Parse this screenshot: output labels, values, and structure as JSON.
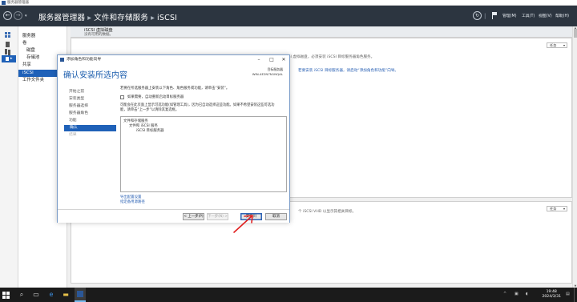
{
  "window": {
    "title": "服务器管理器"
  },
  "nav": {
    "breadcrumb": [
      "服务器管理器",
      "文件和存储服务",
      "iSCSI"
    ],
    "menu": [
      "管理(M)",
      "工具(T)",
      "视图(V)",
      "帮助(H)"
    ]
  },
  "sidebar_tree": {
    "items": [
      {
        "label": "服务器",
        "indent": false,
        "selected": false
      },
      {
        "label": "卷",
        "indent": false,
        "selected": false
      },
      {
        "label": "磁盘",
        "indent": true,
        "selected": false
      },
      {
        "label": "存储池",
        "indent": true,
        "selected": false
      },
      {
        "label": "共享",
        "indent": false,
        "selected": false
      },
      {
        "label": "iSCSI",
        "indent": false,
        "selected": true
      },
      {
        "label": "工作文件夹",
        "indent": false,
        "selected": false
      }
    ]
  },
  "content": {
    "header_title": "iSCSI 虚拟磁盘",
    "header_subtitle": "没有可用的数据。",
    "tasks_label": "任务",
    "hint_main": "要使用 iSCSI 虚拟磁盘，必须安装 iSCSI 目标服务器角色服务。",
    "hint_link": "若要安装 iSCSI 目标服务器，请启动“添加角色和功能”向导。",
    "hint_lower": "个 iSCSI VHD 以显示其相关目标。"
  },
  "dialog": {
    "title": "添加角色和功能向导",
    "heading": "确认安装所选内容",
    "target_server_label": "目标服务器",
    "target_server_name": "WIN-4E2N7N1NQAL",
    "steps": [
      {
        "label": "开始之前",
        "state": "normal"
      },
      {
        "label": "安装类型",
        "state": "normal"
      },
      {
        "label": "服务器选择",
        "state": "normal"
      },
      {
        "label": "服务器角色",
        "state": "normal"
      },
      {
        "label": "功能",
        "state": "normal"
      },
      {
        "label": "确认",
        "state": "active"
      },
      {
        "label": "结果",
        "state": "disabled"
      }
    ],
    "intro": "若要在所选服务器上安装以下角色、角色服务或功能，请单击“安装”。",
    "restart_checkbox": "如果需要，自动重新启动目标服务器",
    "note_line1": "可能会在此页面上显示可选功能(如管理工具)，因为已自动选择这些功能。如果不希望安装这些可选功",
    "note_line2": "能，请单击“上一步”以清除其复选框。",
    "features": [
      {
        "label": "文件和存储服务",
        "level": 0
      },
      {
        "label": "文件和 iSCSI 服务",
        "level": 1
      },
      {
        "label": "iSCSI 目标服务器",
        "level": 2
      }
    ],
    "links": [
      "导出配置设置",
      "指定备用源路径"
    ],
    "buttons": {
      "prev": "< 上一步(P)",
      "next": "下一步(N) >",
      "install": "安装(I)",
      "cancel": "取消"
    }
  },
  "taskbar": {
    "time": "19:48",
    "date": "2024/3/31"
  },
  "colors": {
    "accent": "#1f61b8",
    "navbar": "#2c3540",
    "link": "#2d63b5",
    "annotation": "#e02020"
  }
}
